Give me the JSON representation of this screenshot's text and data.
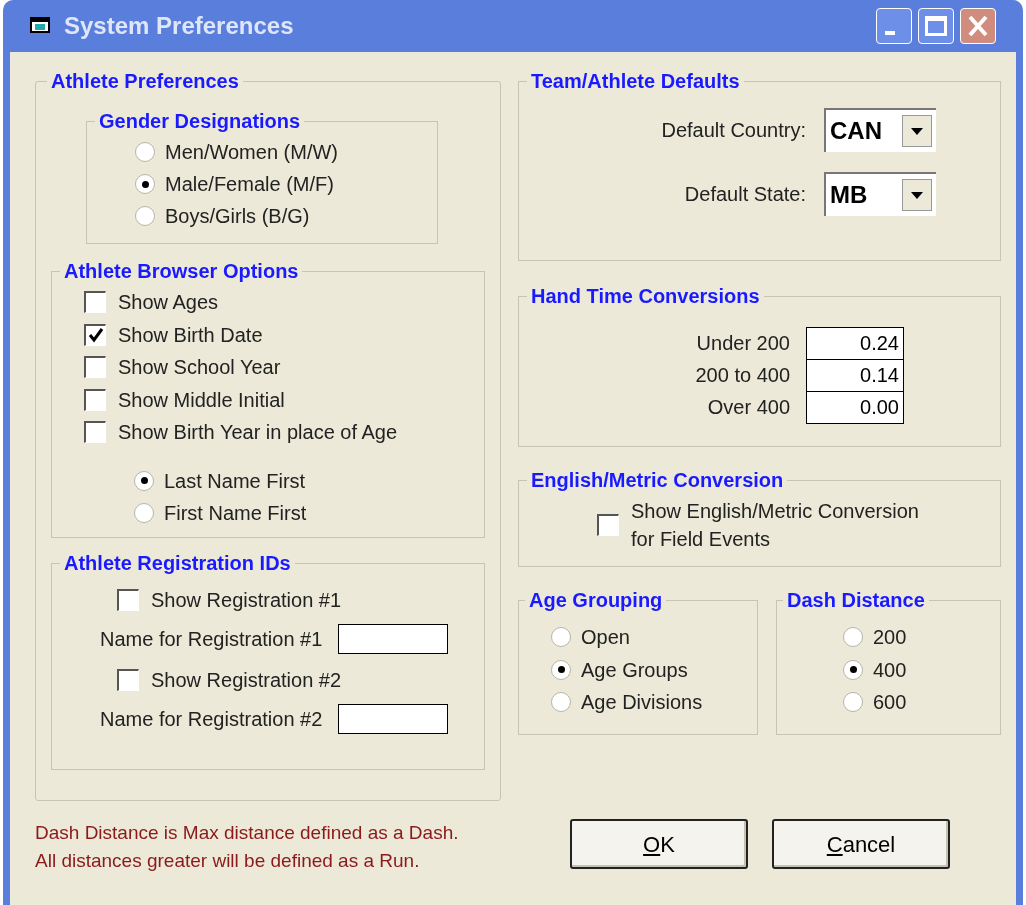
{
  "window": {
    "title": "System Preferences"
  },
  "title_buttons": [
    {
      "kind": "minimize"
    },
    {
      "kind": "maximize"
    },
    {
      "kind": "close"
    }
  ],
  "athlete_preferences": {
    "title": "Athlete Preferences",
    "gender_designations": {
      "title": "Gender Designations",
      "options": [
        {
          "label": "Men/Women (M/W)",
          "selected": false
        },
        {
          "label": "Male/Female (M/F)",
          "selected": true
        },
        {
          "label": "Boys/Girls (B/G)",
          "selected": false
        }
      ]
    },
    "browser_options": {
      "title": "Athlete Browser Options",
      "checkboxes": [
        {
          "label": "Show Ages",
          "checked": false
        },
        {
          "label": "Show Birth Date",
          "checked": true
        },
        {
          "label": "Show School Year",
          "checked": false
        },
        {
          "label": "Show Middle Initial",
          "checked": false
        },
        {
          "label": "Show Birth Year in place of Age",
          "checked": false
        }
      ],
      "name_order": [
        {
          "label": "Last Name First",
          "selected": true
        },
        {
          "label": "First Name First",
          "selected": false
        }
      ]
    },
    "registration_ids": {
      "title": "Athlete Registration IDs",
      "items": [
        {
          "checkbox_label": "Show Registration #1",
          "checked": false,
          "field_label": "Name for Registration #1"
        },
        {
          "checkbox_label": "Show Registration #2",
          "checked": false,
          "field_label": "Name for Registration #2"
        }
      ]
    }
  },
  "team_defaults": {
    "title": "Team/Athlete Defaults",
    "fields": [
      {
        "label": "Default Country:",
        "value": "CAN"
      },
      {
        "label": "Default State:",
        "value": "MB"
      }
    ]
  },
  "hand_time": {
    "title": "Hand Time Conversions",
    "rows": [
      {
        "label": "Under 200",
        "value": "0.24"
      },
      {
        "label": "200 to 400",
        "value": "0.14"
      },
      {
        "label": "Over 400",
        "value": "0.00"
      }
    ]
  },
  "english_metric": {
    "title": "English/Metric Conversion",
    "label": "Show English/Metric Conversion for Field Events",
    "checked": false
  },
  "age_grouping": {
    "title": "Age Grouping",
    "options": [
      {
        "label": "Open",
        "selected": false
      },
      {
        "label": "Age Groups",
        "selected": true
      },
      {
        "label": "Age Divisions",
        "selected": false
      }
    ]
  },
  "dash_distance": {
    "title": "Dash Distance",
    "options": [
      {
        "label": "200",
        "selected": false
      },
      {
        "label": "400",
        "selected": true
      },
      {
        "label": "600",
        "selected": false
      }
    ]
  },
  "note": [
    "Dash Distance is Max distance defined as a Dash.",
    "All distances greater will be defined as a Run."
  ],
  "buttons": [
    {
      "label": "OK",
      "first_letter_underlined": true
    },
    {
      "label": "Cancel",
      "first_letter_underlined": true
    }
  ]
}
